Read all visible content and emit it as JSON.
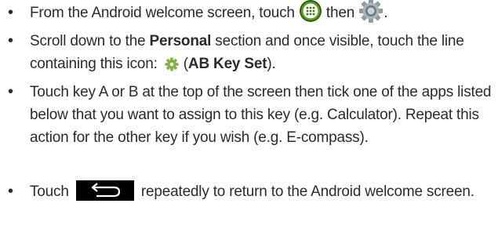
{
  "bullets": {
    "symbol": "•"
  },
  "step1": {
    "text_before": "From the Android welcome screen, touch",
    "text_middle": "then",
    "text_after": ".",
    "apps_icon": "apps-drawer-icon",
    "settings_icon": "settings-gear-icon",
    "apps_icon_color": "#5a9e1f",
    "settings_icon_color": "#9aa7ad"
  },
  "step2": {
    "text_before": "Scroll down to the",
    "bold_personal": "Personal",
    "text_mid": "section and once visible, touch the line containing this icon:",
    "icon": "small-gear-icon",
    "icon_color": "#7cb342",
    "paren_open": "(",
    "bold_key": "AB Key Set",
    "paren_close": ")."
  },
  "step3": {
    "text": "Touch key A or B at the top of the screen then tick one of the apps listed below that you want to assign to this key (e.g. Calculator). Repeat this action for the other key if you wish (e.g. E-compass)."
  },
  "step4": {
    "text_before": "Touch",
    "icon": "back-arrow-icon",
    "text_after": "repeatedly to return to the Android welcome screen."
  }
}
